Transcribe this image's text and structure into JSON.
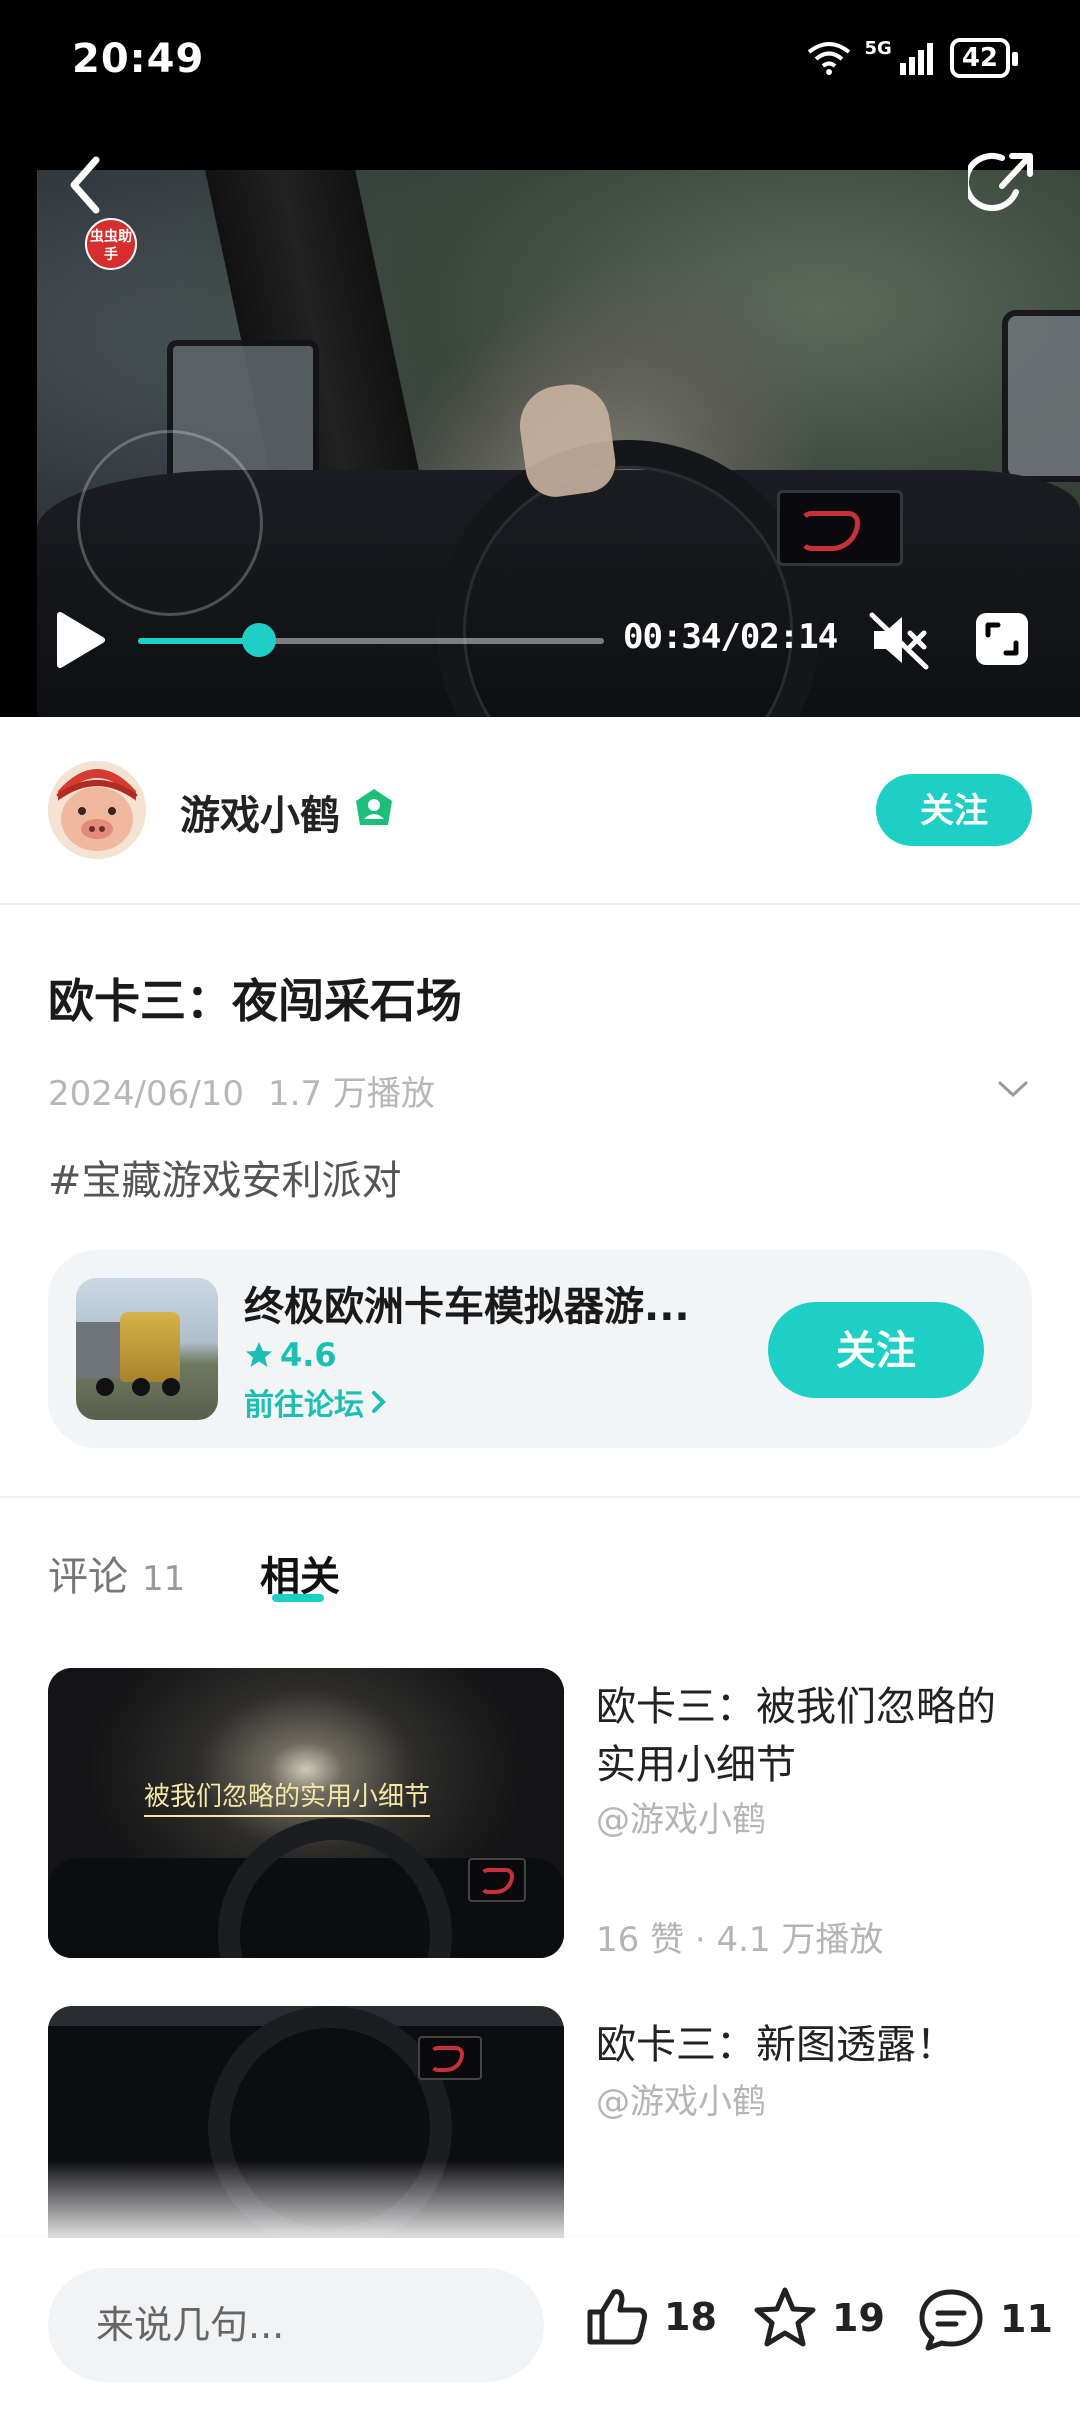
{
  "status_bar": {
    "time": "20:49",
    "network": "5G",
    "battery": "42"
  },
  "video": {
    "badge": "虫虫助手",
    "time_readout": "00:34/02:14",
    "progress_fraction": 0.26,
    "muted": true
  },
  "author": {
    "name": "游戏小鹤",
    "follow_label": "关注"
  },
  "post": {
    "title": "欧卡三：夜闯采石场",
    "date": "2024/06/10",
    "views": "1.7 万播放",
    "hashtag": "#宝藏游戏安利派对"
  },
  "game_card": {
    "name": "终极欧洲卡车模拟器游...",
    "rating": "4.6",
    "forum_link": "前往论坛",
    "follow_label": "关注"
  },
  "tabs": {
    "comments_label": "评论",
    "comments_count": "11",
    "related_label": "相关"
  },
  "related": [
    {
      "title": "欧卡三：被我们忽略的实用小细节",
      "author": "@游戏小鹤",
      "stats": "16 赞 · 4.1 万播放",
      "thumb_caption": "被我们忽略的实用小细节"
    },
    {
      "title": "欧卡三：新图透露！",
      "author": "@游戏小鹤"
    }
  ],
  "bottom_bar": {
    "comment_placeholder": "来说几句...",
    "likes": "18",
    "favorites": "19",
    "comments": "11"
  },
  "colors": {
    "accent": "#1dcfc4",
    "verified": "#1bbf7a"
  }
}
